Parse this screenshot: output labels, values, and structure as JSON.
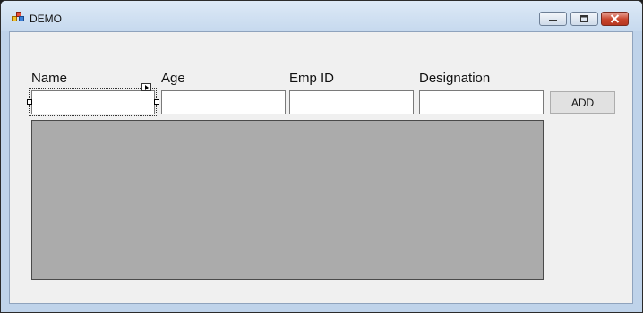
{
  "window": {
    "title": "DEMO",
    "accent_color": "#c8442c",
    "controls": [
      "minimize-icon",
      "maximize-icon",
      "close-icon"
    ]
  },
  "form": {
    "fields": [
      {
        "label": "Name",
        "value": "",
        "placeholder": ""
      },
      {
        "label": "Age",
        "value": "",
        "placeholder": ""
      },
      {
        "label": "Emp ID",
        "value": "",
        "placeholder": ""
      },
      {
        "label": "Designation",
        "value": "",
        "placeholder": ""
      }
    ],
    "add_label": "ADD",
    "grid_background": "#ababab"
  }
}
